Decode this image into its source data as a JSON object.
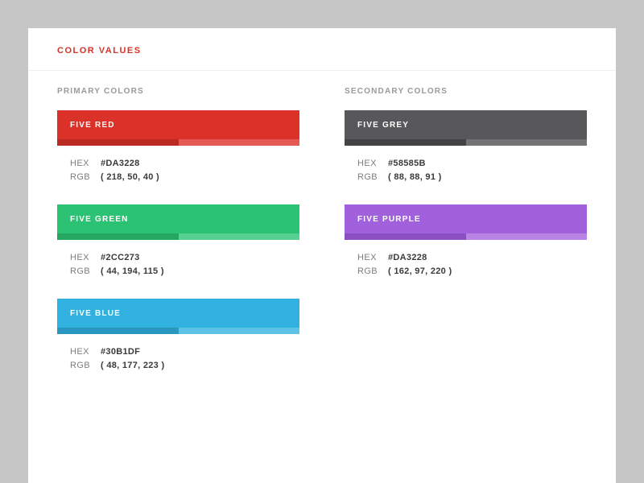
{
  "header": {
    "title": "COLOR VALUES"
  },
  "columns": {
    "primary": {
      "title": "PRIMARY COLORS",
      "swatches": [
        {
          "name": "FIVE RED",
          "main": "#DA3228",
          "dark": "#ba2a22",
          "light": "#e45a52",
          "hex_label": "HEX",
          "hex": "#DA3228",
          "rgb_label": "RGB",
          "rgb": "( 218, 50, 40 )"
        },
        {
          "name": "FIVE GREEN",
          "main": "#2CC273",
          "dark": "#25a762",
          "light": "#57d191",
          "hex_label": "HEX",
          "hex": "#2CC273",
          "rgb_label": "RGB",
          "rgb": "( 44, 194, 115 )"
        },
        {
          "name": "FIVE BLUE",
          "main": "#30B1DF",
          "dark": "#2898c0",
          "light": "#5cc3e7",
          "hex_label": "HEX",
          "hex": "#30B1DF",
          "rgb_label": "RGB",
          "rgb": "( 48, 177, 223 )"
        }
      ]
    },
    "secondary": {
      "title": "SECONDARY COLORS",
      "swatches": [
        {
          "name": "FIVE GREY",
          "main": "#58585B",
          "dark": "#434346",
          "light": "#737376",
          "hex_label": "HEX",
          "hex": "#58585B",
          "rgb_label": "RGB",
          "rgb": "( 88, 88, 91 )"
        },
        {
          "name": "FIVE PURPLE",
          "main": "#A261DC",
          "dark": "#8a4fc0",
          "light": "#b985e5",
          "hex_label": "HEX",
          "hex": "#DA3228",
          "rgb_label": "RGB",
          "rgb": "( 162, 97, 220 )"
        }
      ]
    }
  }
}
